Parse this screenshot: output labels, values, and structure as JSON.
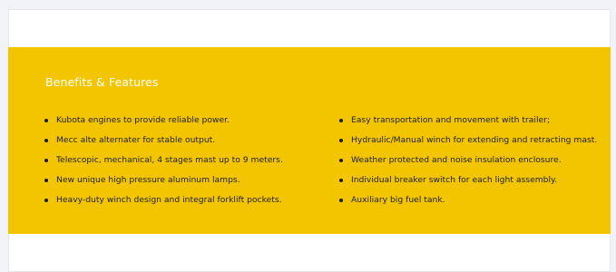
{
  "section": {
    "title": "Benefits & Features",
    "accent_color": "#f2c500",
    "left_features": [
      "Kubota engines to provide reliable power.",
      "Mecc alte alternater for stable output.",
      "Telescopic, mechanical, 4 stages mast up to 9 meters.",
      "New unique high pressure aluminum lamps.",
      "Heavy-duty winch design and integral forklift pockets."
    ],
    "right_features": [
      "Easy transportation and movement with trailer;",
      "Hydraulic/Manual winch for extending and retracting mast.",
      "Weather protected and noise insulation enclosure.",
      "Individual breaker switch for each light assembly.",
      "Auxiliary big fuel tank."
    ]
  }
}
